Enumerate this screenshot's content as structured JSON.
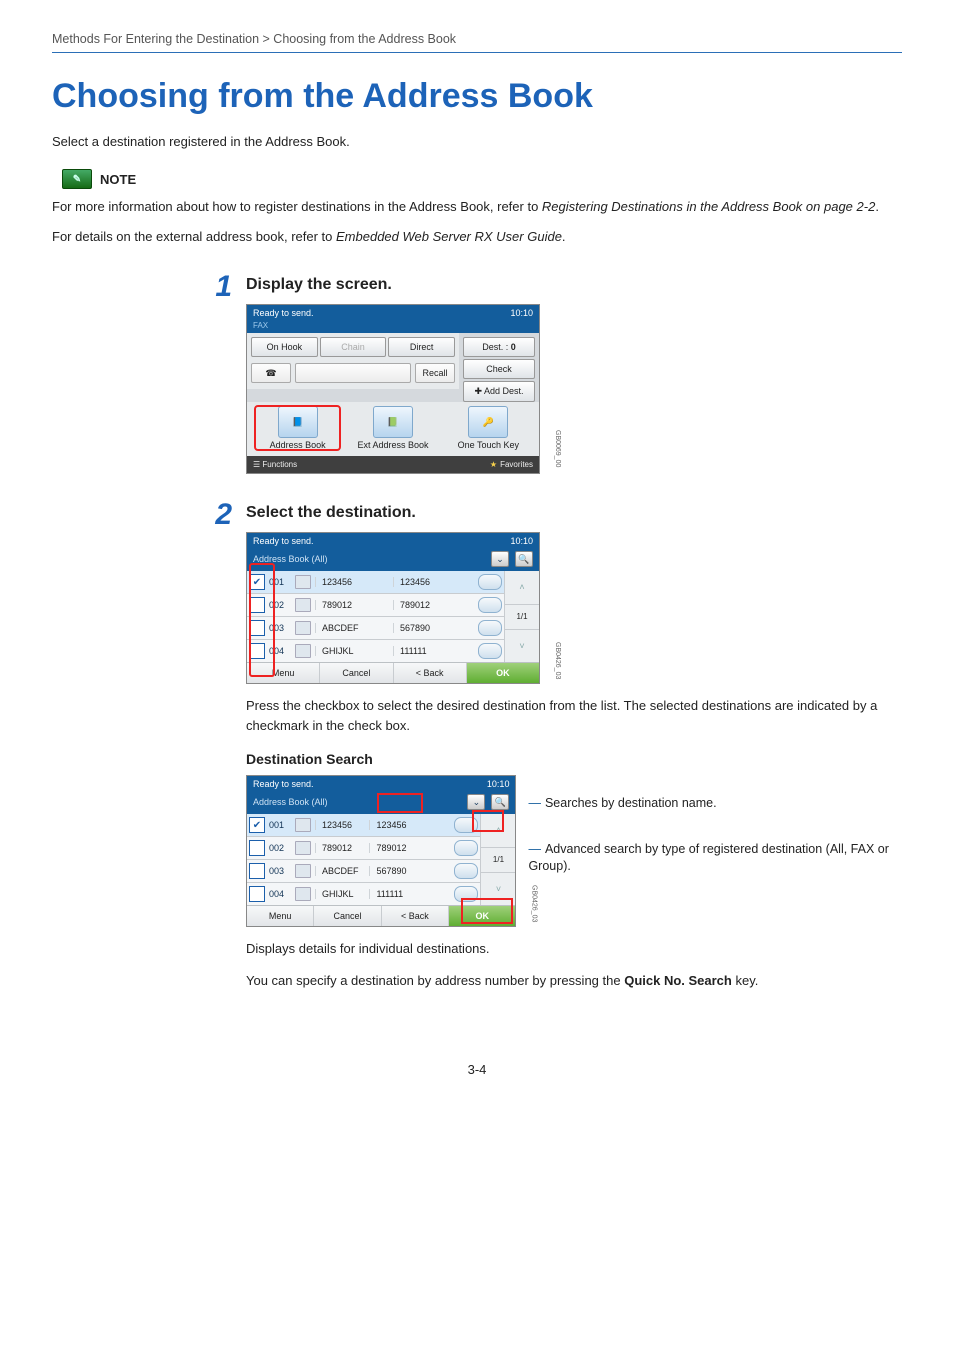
{
  "breadcrumb": "Methods For Entering the Destination > Choosing from the Address Book",
  "title": "Choosing from the Address Book",
  "lead": "Select a destination registered in the Address Book.",
  "note_label": "NOTE",
  "note_line1_a": "For more information about how to register destinations in the Address Book, refer to ",
  "note_line1_ref": "Registering Destinations in the Address Book on page 2-2",
  "note_line2_a": "For details on the external address book, refer to ",
  "note_line2_ref": "Embedded Web Server RX User Guide",
  "step1": {
    "num": "1",
    "title": "Display the screen.",
    "screen": {
      "ready": "Ready to send.",
      "time": "10:10",
      "sub": "FAX",
      "dest_label": "Dest. :",
      "dest_count": "0",
      "check": "Check",
      "on_hook": "On Hook",
      "chain": "Chain",
      "direct": "Direct",
      "recall": "Recall",
      "add_dest": "Add Dest.",
      "big1": "Address Book",
      "big2": "Ext Address Book",
      "big3": "One Touch Key",
      "functions": "Functions",
      "favorites": "Favorites",
      "tag": "GB0069_00"
    }
  },
  "step2": {
    "num": "2",
    "title": "Select the destination.",
    "screen": {
      "ready": "Ready to send.",
      "time": "10:10",
      "sub": "Address Book (All)",
      "rows": [
        {
          "n": "001",
          "name": "123456",
          "fax": "123456",
          "chk": true
        },
        {
          "n": "002",
          "name": "789012",
          "fax": "789012",
          "chk": false
        },
        {
          "n": "003",
          "name": "ABCDEF",
          "fax": "567890",
          "chk": false
        },
        {
          "n": "004",
          "name": "GHIJKL",
          "fax": "111111",
          "chk": false
        }
      ],
      "pager": "1/1",
      "menu": "Menu",
      "cancel": "Cancel",
      "back": "< Back",
      "ok": "OK",
      "tag": "GB0426_03"
    },
    "after": "Press the checkbox to select the desired destination from the list. The selected destinations are indicated by a checkmark in the check box.",
    "search_h": "Destination Search",
    "anno1": "Searches by destination name.",
    "anno2": "Advanced search by type of registered destination (All, FAX or Group).",
    "anno3": "Displays details for individual destinations.",
    "quick": "You can specify a destination by address number by pressing the ",
    "quick_key": "Quick No. Search",
    "quick_tail": " key."
  },
  "page_number": "3-4"
}
